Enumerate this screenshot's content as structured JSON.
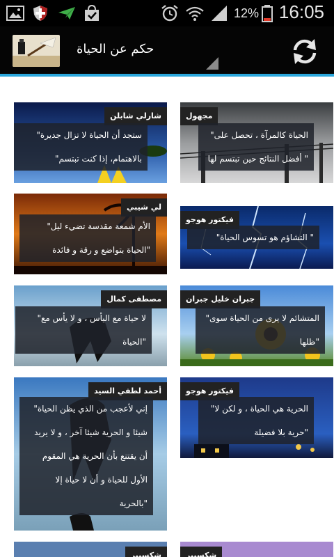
{
  "status_bar": {
    "time": "16:05",
    "battery_percent": "12%",
    "icons": [
      "gallery-icon",
      "shield-icon",
      "send-icon",
      "shopping-bag-icon",
      "alarm-icon",
      "wifi-icon",
      "signal-icon",
      "battery-icon"
    ]
  },
  "action_bar": {
    "title": "حكم عن الحياة",
    "refresh_icon": "refresh-icon"
  },
  "colors": {
    "accent_line": "#2aa7dc",
    "action_bar_bg": "#050505",
    "quote_box": "#1e222a"
  },
  "quotes": [
    {
      "author": "مجهول",
      "lines": [
        "الحياة كالمرآة ، تحصل على\"",
        "\" أفضل النتائج حين تبتسم لها"
      ]
    },
    {
      "author": "شارلي شابلن",
      "lines": [
        "ستجد أن الحياة لا تزال جديرة\"",
        "بالاهتمام، إذا كنت تبتسم\""
      ]
    },
    {
      "author": "فيكتور هوجو",
      "lines": [
        "\" التشاؤم هو تسوس الحياة\""
      ]
    },
    {
      "author": "لي شيبي",
      "lines": [
        "الأم شمعة مقدسة تضيء ليل\"",
        "\"الحياة بتواضع و رقة و فائدة"
      ]
    },
    {
      "author": "جبران خليل جبران",
      "lines": [
        "المتشائم لا يرى من الحياة سوى\"",
        "\"ظلها"
      ]
    },
    {
      "author": "مصطفى كمال",
      "lines": [
        "لا حياة مع اليأس ، و لا يأس مع\"",
        "\"الحياة"
      ]
    },
    {
      "author": "فيكتور هوجو",
      "lines": [
        "الحرية هي الحياة ، و لكن لا\"",
        "\"حرية بلا فضيلة"
      ]
    },
    {
      "author": "أحمد لطفي السيد",
      "lines": [
        "إني لأعجب من الذي يظن الحياة\"",
        "شيئا و الحرية شيئا آخر ، و لا يريد",
        "أن يقتنع بأن الحرية هي المقوم",
        "الأول للحياة و أن لا حياة إلا",
        "\"بالحرية"
      ]
    },
    {
      "author": "شكسبير",
      "lines": []
    },
    {
      "author": "شكسبير",
      "lines": []
    }
  ]
}
